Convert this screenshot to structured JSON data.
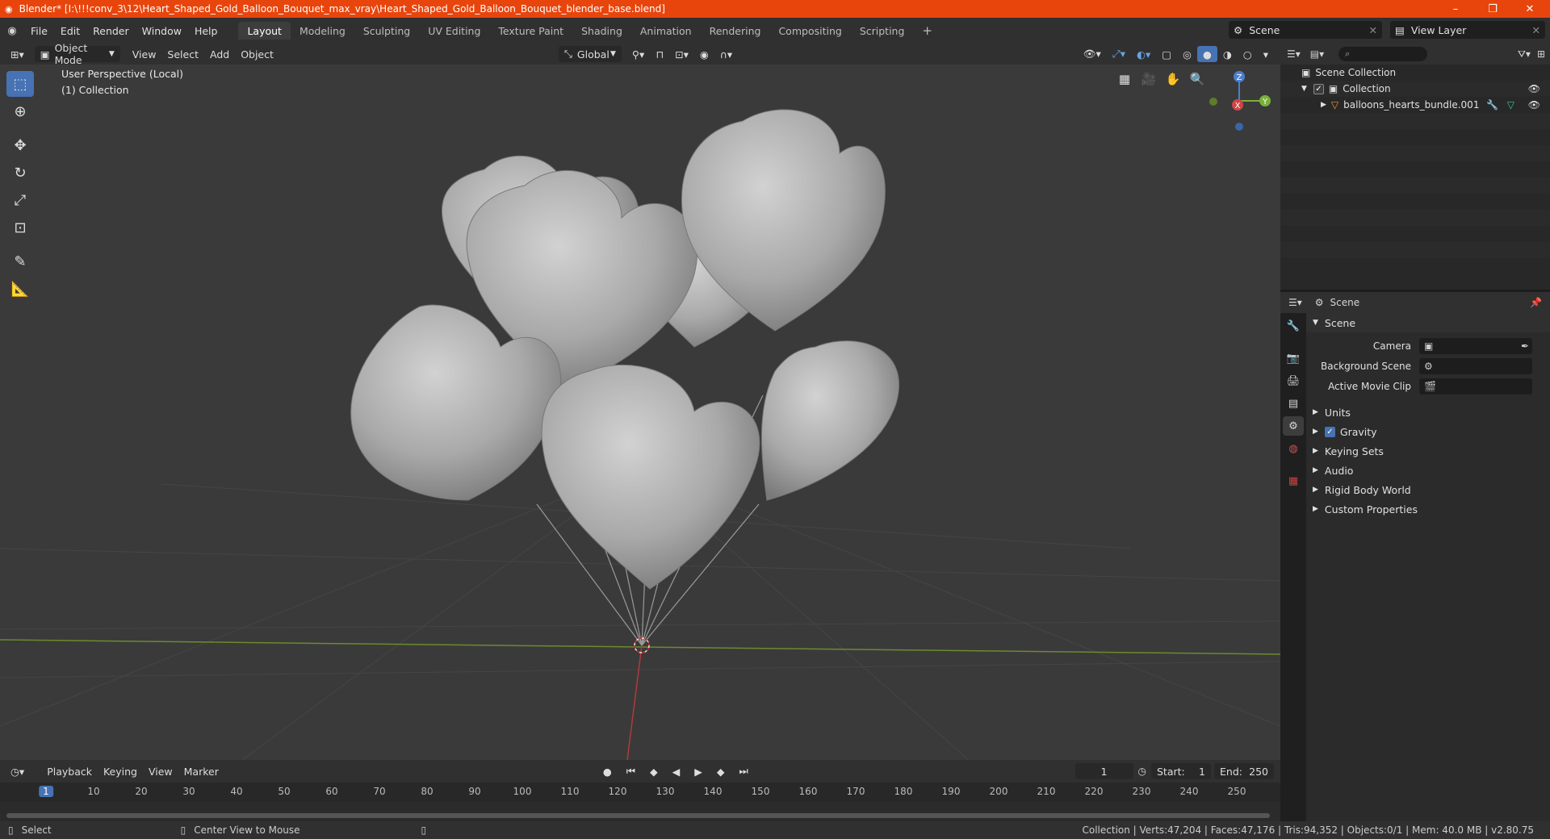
{
  "window": {
    "title": "Blender* [I:\\!!!conv_3\\12\\Heart_Shaped_Gold_Balloon_Bouquet_max_vray\\Heart_Shaped_Gold_Balloon_Bouquet_blender_base.blend]",
    "minimize": "–",
    "restore": "❐",
    "close": "✕"
  },
  "menu": [
    "File",
    "Edit",
    "Render",
    "Window",
    "Help"
  ],
  "workspaces": [
    "Layout",
    "Modeling",
    "Sculpting",
    "UV Editing",
    "Texture Paint",
    "Shading",
    "Animation",
    "Rendering",
    "Compositing",
    "Scripting"
  ],
  "workspace_add": "+",
  "scene_selector": {
    "value": "Scene"
  },
  "view_layer": {
    "value": "View Layer"
  },
  "viewport_header": {
    "mode": "Object Mode",
    "menus": [
      "View",
      "Select",
      "Add",
      "Object"
    ],
    "orientation": "Global"
  },
  "viewport": {
    "perspective": "User Perspective (Local)",
    "collection": "(1) Collection",
    "gizmo": {
      "z": "Z",
      "y": "Y",
      "x": "X"
    }
  },
  "outliner": {
    "search_placeholder": "",
    "scene_collection": "Scene Collection",
    "collection": "Collection",
    "object": "balloons_hearts_bundle.001"
  },
  "properties": {
    "header": "Scene",
    "section_scene": "Scene",
    "camera_label": "Camera",
    "bg_scene_label": "Background Scene",
    "movie_clip_label": "Active Movie Clip",
    "panels": [
      "Units",
      "Gravity",
      "Keying Sets",
      "Audio",
      "Rigid Body World",
      "Custom Properties"
    ]
  },
  "timeline": {
    "menus": [
      "Playback",
      "Keying",
      "View",
      "Marker"
    ],
    "current_frame": "1",
    "start_label": "Start:",
    "start": "1",
    "end_label": "End:",
    "end": "250",
    "ticks": [
      "1",
      "10",
      "20",
      "30",
      "40",
      "50",
      "60",
      "70",
      "80",
      "90",
      "100",
      "110",
      "120",
      "130",
      "140",
      "150",
      "160",
      "170",
      "180",
      "190",
      "200",
      "210",
      "220",
      "230",
      "240",
      "250"
    ]
  },
  "status": {
    "select": "Select",
    "center": "Center View to Mouse",
    "stats": "Collection | Verts:47,204 | Faces:47,176 | Tris:94,352 | Objects:0/1 | Mem: 40.0 MB | v2.80.75"
  },
  "colors": {
    "accent": "#4772b3",
    "titlebar": "#e8450d",
    "grid_x": "#8a3a3a",
    "grid_y": "#6c8a2e"
  }
}
